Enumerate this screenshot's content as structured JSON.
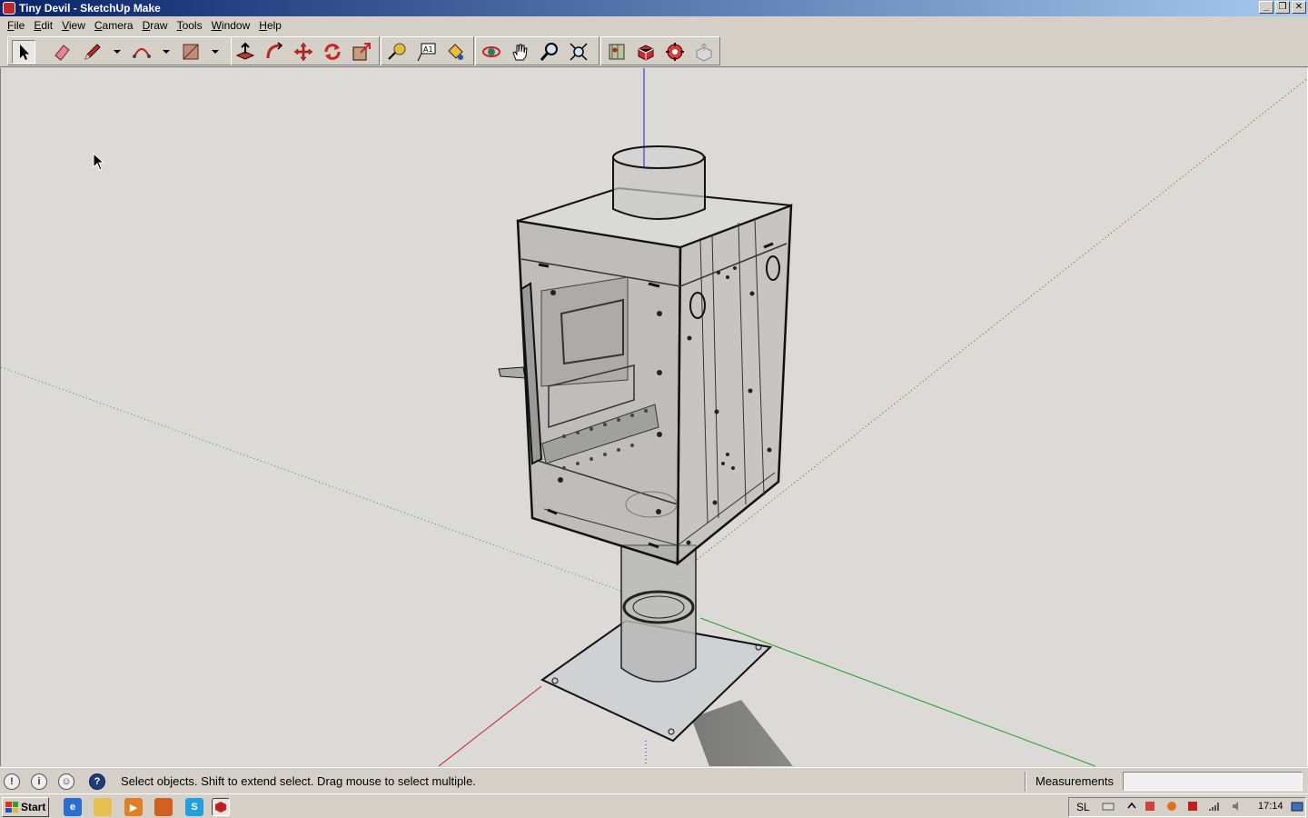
{
  "window": {
    "title": "Tiny Devil - SketchUp Make"
  },
  "menu": [
    "File",
    "Edit",
    "View",
    "Camera",
    "Draw",
    "Tools",
    "Window",
    "Help"
  ],
  "toolbar": {
    "tools": [
      "select",
      "eraser",
      "pencil",
      "arc",
      "rectangle",
      "push-pull",
      "follow-me",
      "move",
      "rotate",
      "scale",
      "tape-measure",
      "text",
      "paint-bucket",
      "orbit",
      "pan",
      "zoom",
      "zoom-extents",
      "add-location",
      "get-models",
      "extension-warehouse",
      "share-model"
    ],
    "active_tool": "select"
  },
  "status": {
    "message": "Select objects. Shift to extend select. Drag mouse to select multiple.",
    "measurements_label": "Measurements",
    "measurements_value": ""
  },
  "taskbar": {
    "start_label": "Start",
    "language": "SL",
    "clock": "17:14"
  },
  "colors": {
    "title_start": "#0a246a",
    "title_end": "#a6caf0",
    "chrome": "#d4d0c8",
    "viewport": "#dcdad6",
    "axis_red": "#d62020",
    "axis_green": "#20a020",
    "axis_blue": "#2020c0"
  }
}
